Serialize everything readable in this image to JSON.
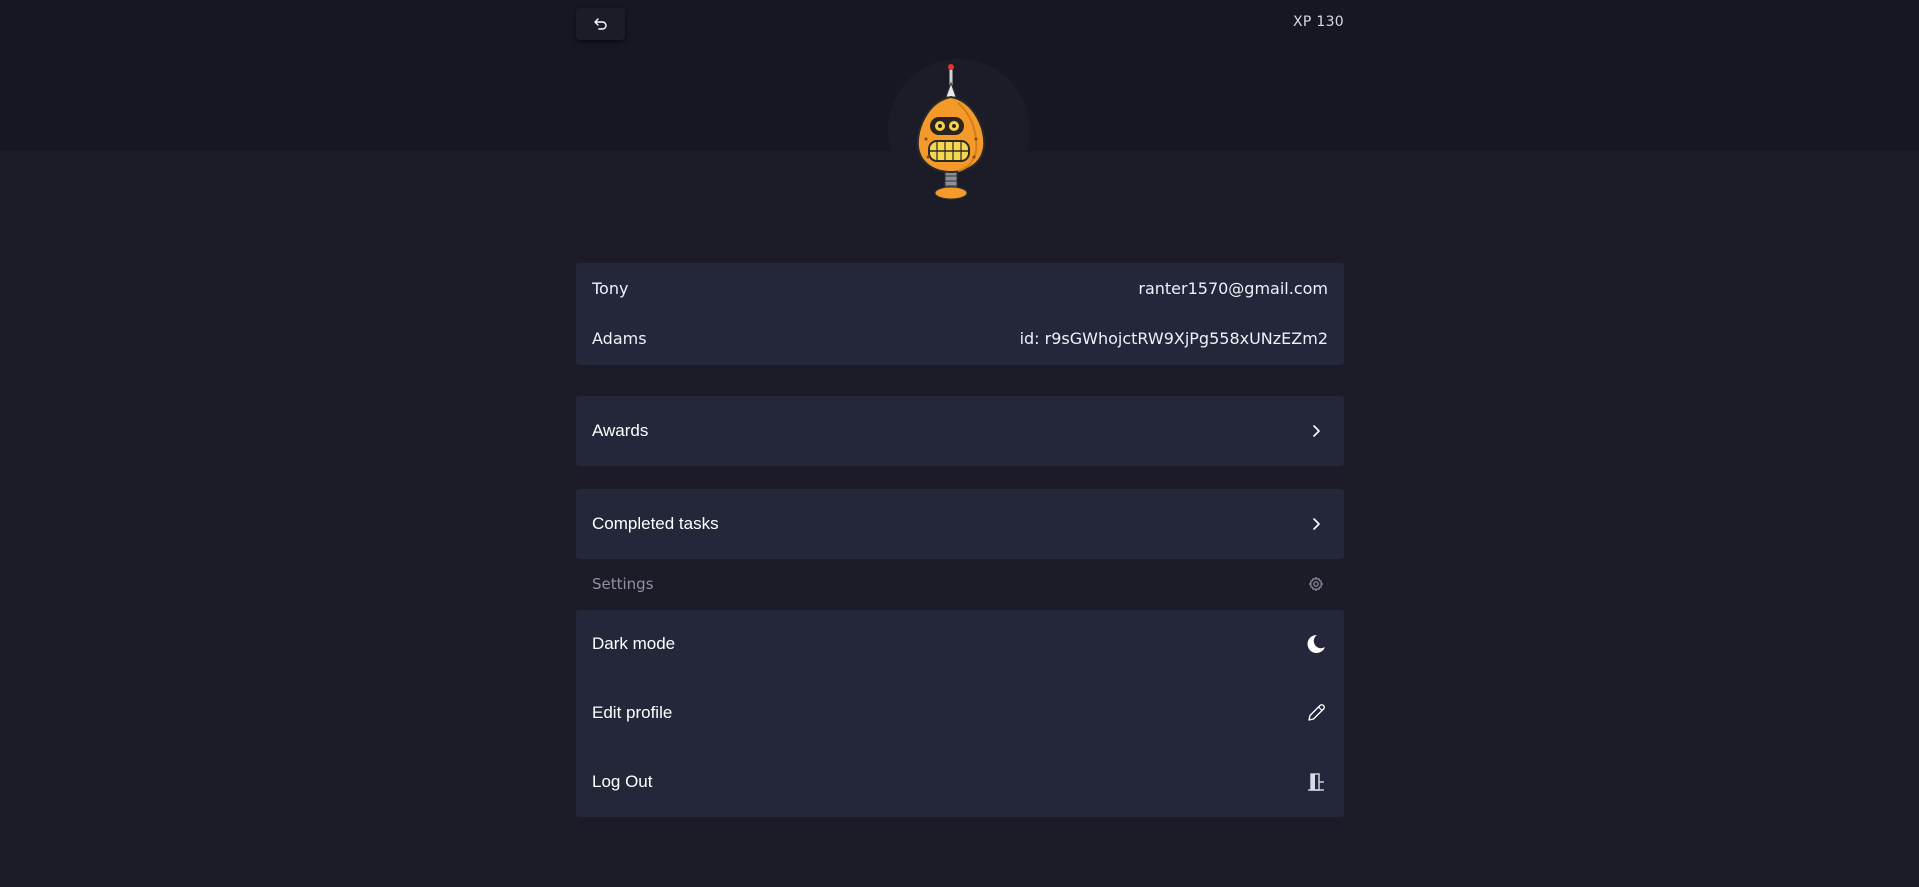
{
  "header": {
    "xp_label": "XP 130"
  },
  "profile": {
    "first_name": "Tony",
    "last_name": "Adams",
    "email": "ranter1570@gmail.com",
    "id_text": "id: r9sGWhojctRW9XjPg558xUNzEZm2"
  },
  "nav": {
    "awards_label": "Awards",
    "completed_tasks_label": "Completed tasks"
  },
  "settings": {
    "heading": "Settings",
    "dark_mode_label": "Dark mode",
    "edit_profile_label": "Edit profile",
    "log_out_label": "Log Out"
  },
  "icons": {
    "back": "undo-arrow-icon",
    "chevron": "chevron-right-icon",
    "settings": "gear-icon",
    "dark_mode": "moon-icon",
    "edit": "pencil-icon",
    "logout": "door-exit-icon"
  },
  "colors": {
    "background": "#1b1c28",
    "header_band": "#161722",
    "card": "#242639",
    "muted_text": "#8e90a3",
    "avatar_orange": "#f39a2b"
  }
}
